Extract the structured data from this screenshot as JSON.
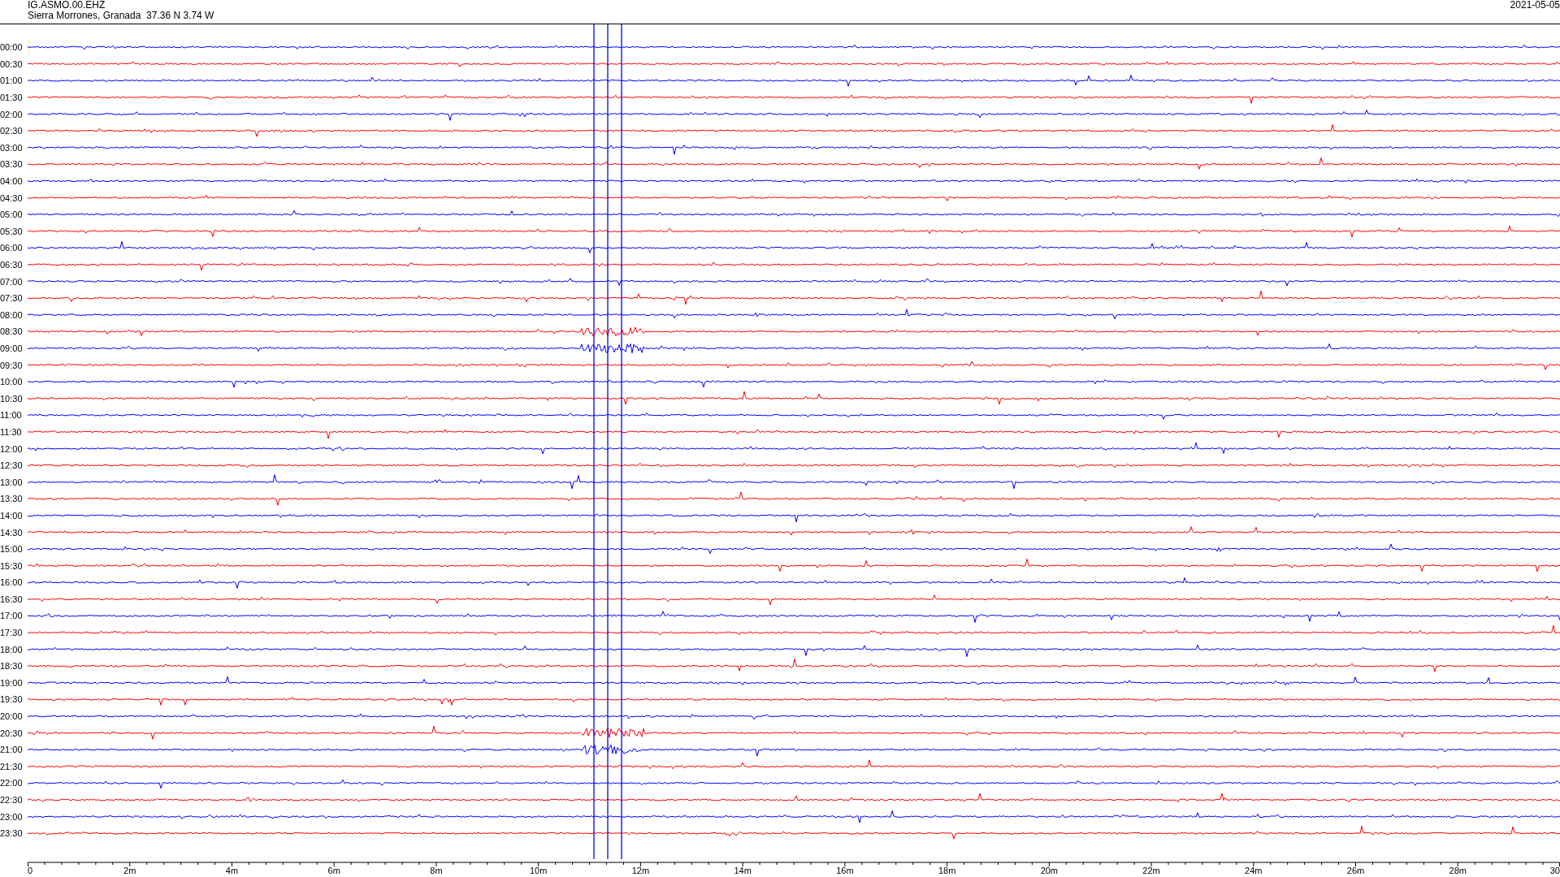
{
  "header": {
    "station": "IG.ASMO.00.EHZ",
    "location": "Sierra Morrones, Granada  37.36 N 3.74 W",
    "date": "2021-05-05"
  },
  "rows": [
    {
      "label": "00:00",
      "color": "#0000ff"
    },
    {
      "label": "00:30",
      "color": "#ff0000"
    },
    {
      "label": "01:00",
      "color": "#0000ff"
    },
    {
      "label": "01:30",
      "color": "#ff0000"
    },
    {
      "label": "02:00",
      "color": "#0000ff"
    },
    {
      "label": "02:30",
      "color": "#ff0000"
    },
    {
      "label": "03:00",
      "color": "#0000ff"
    },
    {
      "label": "03:30",
      "color": "#ff0000"
    },
    {
      "label": "04:00",
      "color": "#0000ff"
    },
    {
      "label": "04:30",
      "color": "#ff0000"
    },
    {
      "label": "05:00",
      "color": "#0000ff"
    },
    {
      "label": "05:30",
      "color": "#ff0000"
    },
    {
      "label": "06:00",
      "color": "#0000ff"
    },
    {
      "label": "06:30",
      "color": "#ff0000"
    },
    {
      "label": "07:00",
      "color": "#0000ff"
    },
    {
      "label": "07:30",
      "color": "#ff0000"
    },
    {
      "label": "08:00",
      "color": "#0000ff"
    },
    {
      "label": "08:30",
      "color": "#ff0000"
    },
    {
      "label": "09:00",
      "color": "#0000ff"
    },
    {
      "label": "09:30",
      "color": "#ff0000"
    },
    {
      "label": "10:00",
      "color": "#0000ff"
    },
    {
      "label": "10:30",
      "color": "#ff0000"
    },
    {
      "label": "11:00",
      "color": "#0000ff"
    },
    {
      "label": "11:30",
      "color": "#ff0000"
    },
    {
      "label": "12:00",
      "color": "#0000ff"
    },
    {
      "label": "12:30",
      "color": "#ff0000"
    },
    {
      "label": "13:00",
      "color": "#0000ff"
    },
    {
      "label": "13:30",
      "color": "#ff0000"
    },
    {
      "label": "14:00",
      "color": "#0000ff"
    },
    {
      "label": "14:30",
      "color": "#ff0000"
    },
    {
      "label": "15:00",
      "color": "#0000ff"
    },
    {
      "label": "15:30",
      "color": "#ff0000"
    },
    {
      "label": "16:00",
      "color": "#0000ff"
    },
    {
      "label": "16:30",
      "color": "#ff0000"
    },
    {
      "label": "17:00",
      "color": "#0000ff"
    },
    {
      "label": "17:30",
      "color": "#ff0000"
    },
    {
      "label": "18:00",
      "color": "#0000ff"
    },
    {
      "label": "18:30",
      "color": "#ff0000"
    },
    {
      "label": "19:00",
      "color": "#0000ff"
    },
    {
      "label": "19:30",
      "color": "#ff0000"
    },
    {
      "label": "20:00",
      "color": "#0000ff"
    },
    {
      "label": "20:30",
      "color": "#ff0000"
    },
    {
      "label": "21:00",
      "color": "#0000ff"
    },
    {
      "label": "21:30",
      "color": "#ff0000"
    },
    {
      "label": "22:00",
      "color": "#0000ff"
    },
    {
      "label": "22:30",
      "color": "#ff0000"
    },
    {
      "label": "23:00",
      "color": "#0000ff"
    },
    {
      "label": "23:30",
      "color": "#ff0000"
    }
  ],
  "x_axis": {
    "labels": [
      "0",
      "2m",
      "4m",
      "6m",
      "8m",
      "10m",
      "12m",
      "14m",
      "16m",
      "18m",
      "20m",
      "22m",
      "24m",
      "26m",
      "28m",
      "30"
    ]
  }
}
